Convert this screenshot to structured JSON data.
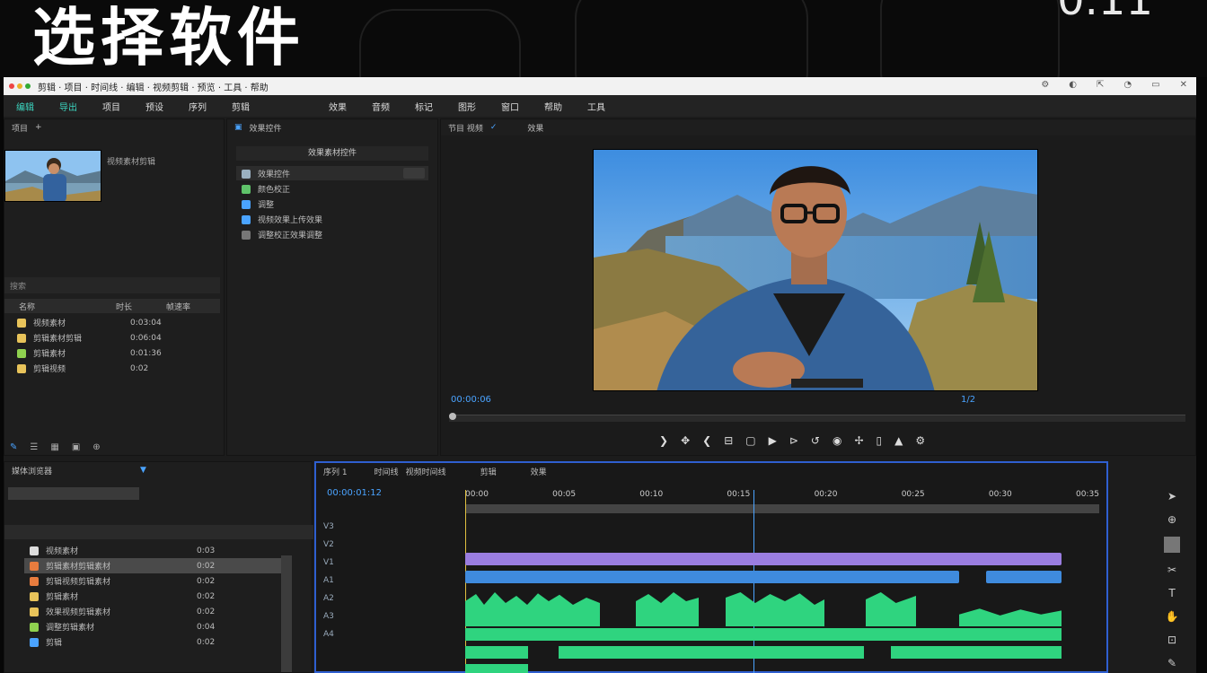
{
  "banner": {
    "title": "选择软件",
    "corner": "0.11"
  },
  "app": {
    "titlebar": {
      "title": "剪辑 · 项目 · 时间线 · 编辑 · 视频剪辑 · 预览 · 工具 · 帮助",
      "controls": [
        "⚙",
        "◐",
        "⇱",
        "◔",
        "▭",
        "✕"
      ]
    },
    "menu": [
      "编辑",
      "导出",
      "项目",
      "预设",
      "序列",
      "剪辑",
      "效果",
      "音频",
      "标记",
      "图形",
      "窗口",
      "帮助",
      "工具"
    ],
    "project_panel": {
      "tab": "项目",
      "clip_label": "视频素材剪辑",
      "search_placeholder": "搜索",
      "columns": [
        "名称",
        "时长",
        "帧速率"
      ],
      "items": [
        {
          "name": "视频素材",
          "dur": "0:03:04",
          "color": "#e8c35a"
        },
        {
          "name": "剪辑素材剪辑",
          "dur": "0:06:04",
          "color": "#e8c35a"
        },
        {
          "name": "剪辑素材",
          "dur": "0:01:36",
          "color": "#8fd14f"
        },
        {
          "name": "剪辑视频",
          "dur": "0:02",
          "color": "#e8c35a"
        }
      ]
    },
    "effects_panel": {
      "tab": "效果控件",
      "header": "效果素材控件",
      "items": [
        "效果控件",
        "颜色校正",
        "调整",
        "视频效果上传效果",
        "调整校正效果调整"
      ]
    },
    "program": {
      "tab": "节目 视频",
      "tab2": "效果",
      "timecode": "00:00:06",
      "right": "1/2"
    },
    "timeline": {
      "tab": "序列 1",
      "tabs": [
        "时间线",
        "视频时间线",
        "剪辑",
        "效果"
      ],
      "timecode": "00:00:01:12",
      "ruler": [
        "00:00",
        "00:05",
        "00:10",
        "00:15",
        "00:20",
        "00:25",
        "00:30",
        "00:35"
      ],
      "tracks": [
        "V3",
        "V2",
        "V1",
        "A1",
        "A2",
        "A3",
        "A4"
      ]
    },
    "bin": {
      "tab": "媒体浏览器",
      "list": [
        {
          "name": "视频素材",
          "v": "0:03"
        },
        {
          "name": "剪辑素材剪辑素材",
          "v": "0:02"
        },
        {
          "name": "剪辑视频剪辑素材",
          "v": "0:02"
        },
        {
          "name": "剪辑素材",
          "v": "0:02"
        },
        {
          "name": "效果视频剪辑素材",
          "v": "0:02"
        },
        {
          "name": "调整剪辑素材",
          "v": "0:04"
        },
        {
          "name": "剪辑",
          "v": "0:02"
        }
      ]
    }
  }
}
